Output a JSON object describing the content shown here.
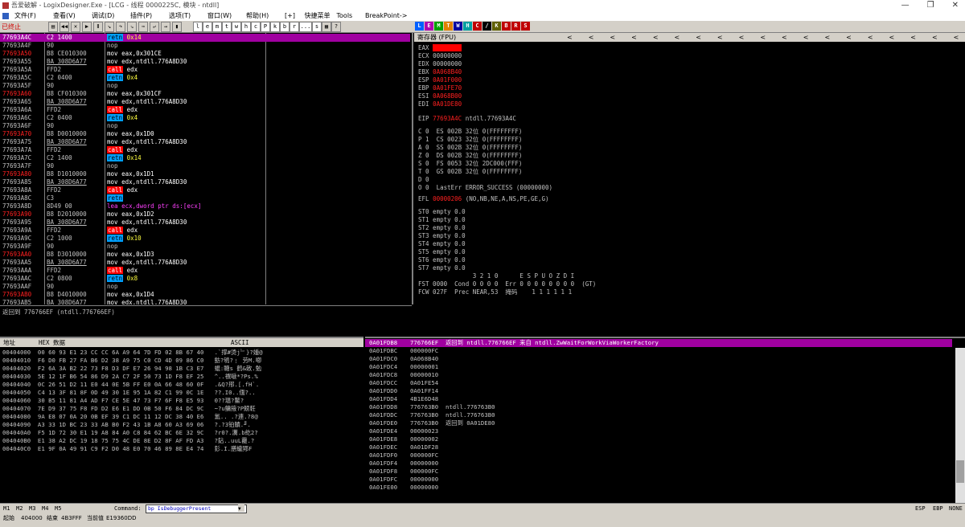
{
  "window": {
    "title": "吾爱破解 - LogixDesigner.Exe - [LCG - 线程 0000225C, 模块 - ntdll]"
  },
  "menu": [
    "文件(F)",
    "查看(V)",
    "调试(D)",
    "插件(P)",
    "选项(T)",
    "窗口(W)",
    "帮助(H)",
    "[+]",
    "快捷菜单",
    "Tools",
    "BreakPoint->"
  ],
  "toolbar": {
    "status": "已终止",
    "letters": [
      "l",
      "e",
      "m",
      "t",
      "w",
      "h",
      "c",
      "P",
      "k",
      "b",
      "r",
      "...",
      "s"
    ],
    "colored": [
      {
        "label": "L",
        "color": "#0060ff"
      },
      {
        "label": "E",
        "color": "#b000b0"
      },
      {
        "label": "M",
        "color": "#00a000"
      },
      {
        "label": "T",
        "color": "#e08000"
      },
      {
        "label": "W",
        "color": "#0000a0"
      },
      {
        "label": "H",
        "color": "#00a0a0"
      },
      {
        "label": "C",
        "color": "#c00000"
      },
      {
        "label": "/",
        "color": "#000000"
      },
      {
        "label": "K",
        "color": "#606000"
      },
      {
        "label": "B",
        "color": "#c00000"
      },
      {
        "label": "R",
        "color": "#c00000"
      },
      {
        "label": "S",
        "color": "#c00000"
      }
    ]
  },
  "disasm": [
    {
      "addr": "77693A4C",
      "hex": "C2 1400",
      "op": "retn",
      "arg": "0x14",
      "kind": "retn",
      "sel": true
    },
    {
      "addr": "77693A4F",
      "hex": "90",
      "op": "nop",
      "arg": "",
      "kind": "nop"
    },
    {
      "addr": "77693A50",
      "hex": "B8 CE010300",
      "op": "mov",
      "arg": "eax,0x301CE",
      "kind": "mov",
      "red": true
    },
    {
      "addr": "77693A55",
      "hex": "BA 308D6A77",
      "op": "mov",
      "arg": "edx,ntdll.776A8D30",
      "kind": "mov",
      "u": true
    },
    {
      "addr": "77693A5A",
      "hex": "FFD2",
      "op": "call",
      "arg": "edx",
      "kind": "call"
    },
    {
      "addr": "77693A5C",
      "hex": "C2 0400",
      "op": "retn",
      "arg": "0x4",
      "kind": "retn"
    },
    {
      "addr": "77693A5F",
      "hex": "90",
      "op": "nop",
      "arg": "",
      "kind": "nop"
    },
    {
      "addr": "77693A60",
      "hex": "B8 CF010300",
      "op": "mov",
      "arg": "eax,0x301CF",
      "kind": "mov",
      "red": true
    },
    {
      "addr": "77693A65",
      "hex": "BA 308D6A77",
      "op": "mov",
      "arg": "edx,ntdll.776A8D30",
      "kind": "mov",
      "u": true
    },
    {
      "addr": "77693A6A",
      "hex": "FFD2",
      "op": "call",
      "arg": "edx",
      "kind": "call"
    },
    {
      "addr": "77693A6C",
      "hex": "C2 0400",
      "op": "retn",
      "arg": "0x4",
      "kind": "retn"
    },
    {
      "addr": "77693A6F",
      "hex": "90",
      "op": "nop",
      "arg": "",
      "kind": "nop"
    },
    {
      "addr": "77693A70",
      "hex": "B8 D0010000",
      "op": "mov",
      "arg": "eax,0x1D0",
      "kind": "mov",
      "red": true
    },
    {
      "addr": "77693A75",
      "hex": "BA 308D6A77",
      "op": "mov",
      "arg": "edx,ntdll.776A8D30",
      "kind": "mov",
      "u": true
    },
    {
      "addr": "77693A7A",
      "hex": "FFD2",
      "op": "call",
      "arg": "edx",
      "kind": "call"
    },
    {
      "addr": "77693A7C",
      "hex": "C2 1400",
      "op": "retn",
      "arg": "0x14",
      "kind": "retn"
    },
    {
      "addr": "77693A7F",
      "hex": "90",
      "op": "nop",
      "arg": "",
      "kind": "nop"
    },
    {
      "addr": "77693A80",
      "hex": "B8 D1010000",
      "op": "mov",
      "arg": "eax,0x1D1",
      "kind": "mov",
      "red": true
    },
    {
      "addr": "77693A85",
      "hex": "BA 308D6A77",
      "op": "mov",
      "arg": "edx,ntdll.776A8D30",
      "kind": "mov",
      "u": true
    },
    {
      "addr": "77693A8A",
      "hex": "FFD2",
      "op": "call",
      "arg": "edx",
      "kind": "call"
    },
    {
      "addr": "77693A8C",
      "hex": "C3",
      "op": "retn",
      "arg": "",
      "kind": "retn"
    },
    {
      "addr": "77693A8D",
      "hex": "8D49 00",
      "op": "lea",
      "arg": "ecx,dword ptr ds:[ecx]",
      "kind": "lea"
    },
    {
      "addr": "77693A90",
      "hex": "B8 D2010000",
      "op": "mov",
      "arg": "eax,0x1D2",
      "kind": "mov",
      "red": true
    },
    {
      "addr": "77693A95",
      "hex": "BA 308D6A77",
      "op": "mov",
      "arg": "edx,ntdll.776A8D30",
      "kind": "mov",
      "u": true
    },
    {
      "addr": "77693A9A",
      "hex": "FFD2",
      "op": "call",
      "arg": "edx",
      "kind": "call"
    },
    {
      "addr": "77693A9C",
      "hex": "C2 1000",
      "op": "retn",
      "arg": "0x10",
      "kind": "retn"
    },
    {
      "addr": "77693A9F",
      "hex": "90",
      "op": "nop",
      "arg": "",
      "kind": "nop"
    },
    {
      "addr": "77693AA0",
      "hex": "B8 D3010000",
      "op": "mov",
      "arg": "eax,0x1D3",
      "kind": "mov",
      "red": true
    },
    {
      "addr": "77693AA5",
      "hex": "BA 308D6A77",
      "op": "mov",
      "arg": "edx,ntdll.776A8D30",
      "kind": "mov",
      "u": true
    },
    {
      "addr": "77693AAA",
      "hex": "FFD2",
      "op": "call",
      "arg": "edx",
      "kind": "call"
    },
    {
      "addr": "77693AAC",
      "hex": "C2 0800",
      "op": "retn",
      "arg": "0x8",
      "kind": "retn"
    },
    {
      "addr": "77693AAF",
      "hex": "90",
      "op": "nop",
      "arg": "",
      "kind": "nop"
    },
    {
      "addr": "77693AB0",
      "hex": "B8 D4010000",
      "op": "mov",
      "arg": "eax,0x1D4",
      "kind": "mov",
      "red": true
    },
    {
      "addr": "77693AB5",
      "hex": "BA 308D6A77",
      "op": "mov",
      "arg": "edx,ntdll.776A8D30",
      "kind": "mov",
      "u": true
    }
  ],
  "info_line": "返回到 776766EF (ntdll.776766EF)",
  "registers": {
    "header": "寄存器 (FPU)",
    "gp": [
      {
        "name": "EAX",
        "value": "00000000",
        "hl": true
      },
      {
        "name": "ECX",
        "value": "00000000"
      },
      {
        "name": "EDX",
        "value": "00000000"
      },
      {
        "name": "EBX",
        "value": "0A068B40",
        "red": true
      },
      {
        "name": "ESP",
        "value": "0A01F000",
        "red": true
      },
      {
        "name": "EBP",
        "value": "0A01FE70",
        "red": true
      },
      {
        "name": "ESI",
        "value": "0A068B00",
        "red": true
      },
      {
        "name": "EDI",
        "value": "0A01DE80",
        "red": true
      }
    ],
    "eip": {
      "value": "77693A4C",
      "comment": "ntdll.77693A4C"
    },
    "flags": [
      "C 0  ES 002B 32位 0(FFFFFFFF)",
      "P 1  CS 0023 32位 0(FFFFFFFF)",
      "A 0  SS 002B 32位 0(FFFFFFFF)",
      "Z 0  DS 002B 32位 0(FFFFFFFF)",
      "S 0  FS 0053 32位 2DC000(FFF)",
      "T 0  GS 002B 32位 0(FFFFFFFF)",
      "D 0",
      "O 0  LastErr ERROR_SUCCESS (00000000)"
    ],
    "efl": {
      "value": "00000206",
      "comment": "(NO,NB,NE,A,NS,PE,GE,G)"
    },
    "fpu": [
      "ST0 empty 0.0",
      "ST1 empty 0.0",
      "ST2 empty 0.0",
      "ST3 empty 0.0",
      "ST4 empty 0.0",
      "ST5 empty 0.0",
      "ST6 empty 0.0",
      "ST7 empty 0.0"
    ],
    "fpu_hdr": "               3 2 1 0      E S P U O Z D I",
    "fst": "FST 0000  Cond 0 0 0 0  Err 0 0 0 0 0 0 0 0  (GT)",
    "fcw": "FCW 027F  Prec NEAR,53  掩码    1 1 1 1 1 1"
  },
  "dump": {
    "headers": [
      "地址",
      "HEX 数据",
      "ASCII"
    ],
    "rows": [
      "00404000  00 60 93 E1 23 CC CC 6A A9 64 7D FD 02 8B 67 40   .`撑#烫j﹄}?媑@",
      "00404010  F6 D0 FB 27 FA B6 D2 38 A9 75 C0 CD 4D 09 86 C0   鲂?鸲?﹗ 劳M.喞",
      "00404020  F2 6A 3A B2 22 73 F8 D3 DF E7 26 94 98 1B C3 E7   蜫:瞊s 鹤&敇.勉",
      "00404030  5E 12 1F B6 54 86 D9 2A C7 2F 50 73 1D F8 EF 25   ^..禩嗁*?Ps.%",
      "00404040  0C 26 51 D2 11 E0 44 0E 5B FF E0 0A 66 48 60 0F   .&Q?郉.[.fH`.",
      "00404050  C4 13 3F 81 8F 0D 49 30 1E 95 1A 82 C1 99 0C 1E   ??.I0..偭?..",
      "00404060  30 B5 11 81 A4 AD F7 CE 5E 47 73 F7 6F F8 E5 93   0??瑥?鳌?",
      "00404070  7E D9 37 75 F8 FD D2 E6 E1 DD 0B 50 F6 84 DC 9C   ~?u鳙掖?P鰟軠",
      "00404080  9A E8 07 0A 20 0B EF 39 C1 DC 11 12 DC 38 40 E6   氳.. .?連.?8@",
      "00404090  A3 33 1D BC 23 33 AB B0 F2 43 1B A8 60 A3 69 06   ?.?3铂鰿.╜.",
      "004040A0  F5 1D 72 30 E1 19 A8 84 A0 C8 84 62 BC 6E 32 9C   ?r0?.瀵.b紇2?",
      "004040B0  E1 38 A2 DC 19 18 75 75 4C DE 8E D2 8F AF FD A3   ?鉆..uuL龗.?",
      "004040C0  E1 9F 0A 49 91 C9 F2 D0 48 E0 70 46 89 8E E4 74   釤.I.膳蠬鄍F"
    ]
  },
  "stack": {
    "rows": [
      {
        "a": "0A01FDB8",
        "v": "776766EF",
        "c": "返回到 ntdll.776766EF 来自 ntdll.ZwWaitForWorkViaWorkerFactory",
        "sel": true
      },
      {
        "a": "0A01FDBC",
        "v": "000000FC",
        "c": ""
      },
      {
        "a": "0A01FDC0",
        "v": "0A068B40",
        "c": ""
      },
      {
        "a": "0A01FDC4",
        "v": "00000001",
        "c": ""
      },
      {
        "a": "0A01FDC8",
        "v": "00000010",
        "c": ""
      },
      {
        "a": "0A01FDCC",
        "v": "0A01FE54",
        "c": ""
      },
      {
        "a": "0A01FDD0",
        "v": "0A01FF14",
        "c": ""
      },
      {
        "a": "0A01FDD4",
        "v": "4B1E6D48",
        "c": ""
      },
      {
        "a": "0A01FDD8",
        "v": "776763B0",
        "c": "ntdll.776763B0"
      },
      {
        "a": "0A01FDDC",
        "v": "776763B0",
        "c": "ntdll.776763B0"
      },
      {
        "a": "0A01FDE0",
        "v": "776763B0",
        "c": "返回到 0A01DE80"
      },
      {
        "a": "0A01FDE4",
        "v": "00000023",
        "c": ""
      },
      {
        "a": "0A01FDE8",
        "v": "00000002",
        "c": ""
      },
      {
        "a": "0A01FDEC",
        "v": "0A01DF28",
        "c": ""
      },
      {
        "a": "0A01FDF0",
        "v": "000000FC",
        "c": ""
      },
      {
        "a": "0A01FDF4",
        "v": "00000000",
        "c": ""
      },
      {
        "a": "0A01FDF8",
        "v": "000000FC",
        "c": ""
      },
      {
        "a": "0A01FDFC",
        "v": "00000000",
        "c": ""
      },
      {
        "a": "0A01FE00",
        "v": "00000000",
        "c": ""
      }
    ]
  },
  "cmdbar": {
    "m_buttons": [
      "M1",
      "M2",
      "M3",
      "M4",
      "M5"
    ],
    "label": "Command:",
    "value": "bp IsDebuggerPresent",
    "right": [
      "ESP",
      "EBP",
      "NONE"
    ]
  },
  "statusbar": {
    "start_label": "起始",
    "start": "404000",
    "end_label": "结束",
    "end": "4B3FFF",
    "cur_label": "当前值",
    "cur": "E19360DD"
  }
}
